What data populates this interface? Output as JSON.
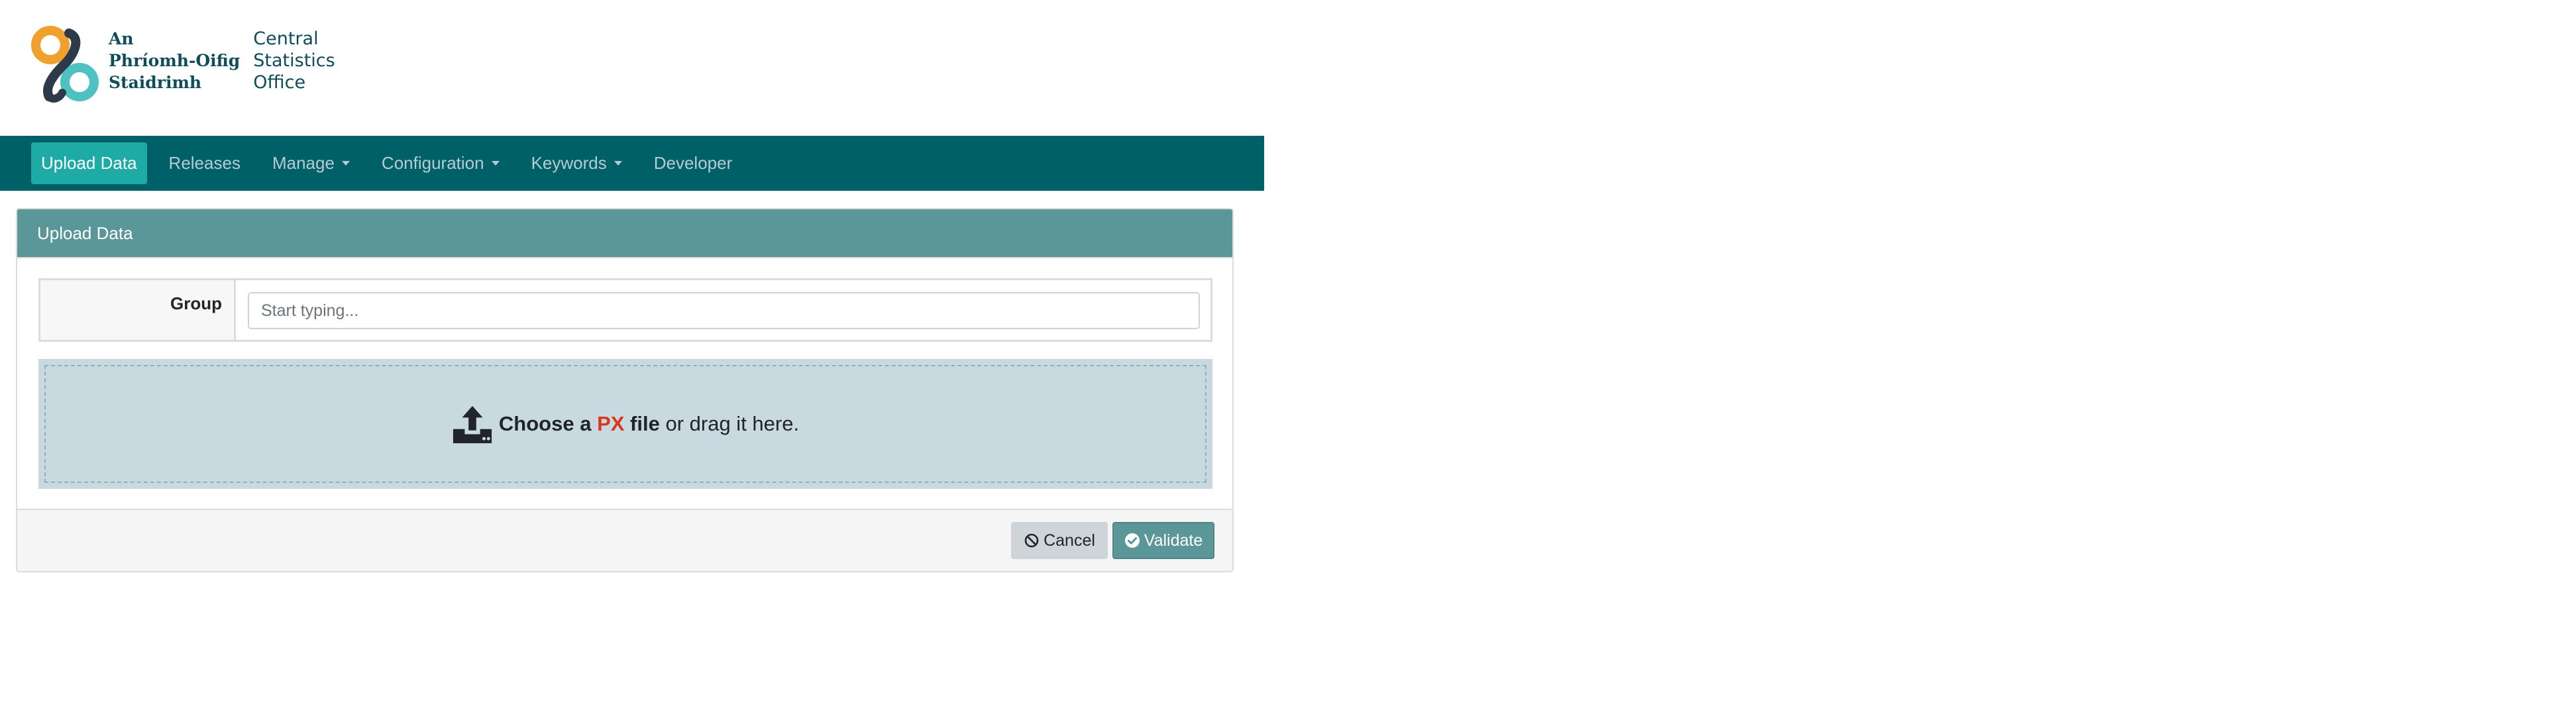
{
  "logo": {
    "irish_lines": [
      "An",
      "Phríomh-Oifig",
      "Staidrimh"
    ],
    "english_lines": [
      "Central",
      "Statistics",
      "Office"
    ]
  },
  "navbar": {
    "items": [
      {
        "label": "Upload Data",
        "active": true,
        "dropdown": false
      },
      {
        "label": "Releases",
        "active": false,
        "dropdown": false
      },
      {
        "label": "Manage",
        "active": false,
        "dropdown": true
      },
      {
        "label": "Configuration",
        "active": false,
        "dropdown": true
      },
      {
        "label": "Keywords",
        "active": false,
        "dropdown": true
      },
      {
        "label": "Developer",
        "active": false,
        "dropdown": false
      }
    ]
  },
  "upload": {
    "title": "Upload Data",
    "group_label": "Group",
    "group_placeholder": "Start typing...",
    "group_value": "",
    "dropzone": {
      "icon": "upload-icon",
      "choose": "Choose a",
      "format": "PX",
      "file": "file",
      "rest": "or drag it here."
    },
    "cancel_label": "Cancel",
    "cancel_icon": "ban-icon",
    "validate_label": "Validate",
    "validate_icon": "check-circle-icon"
  },
  "colors": {
    "navbar": "#006068",
    "nav_active": "#1eaaa5",
    "card_header": "#5b9699",
    "dropzone": "#c8d9df",
    "px_accent": "#d9381e",
    "logo_orange": "#f0a02c",
    "logo_teal": "#4ec2c2",
    "logo_dark": "#2d3a4a"
  }
}
